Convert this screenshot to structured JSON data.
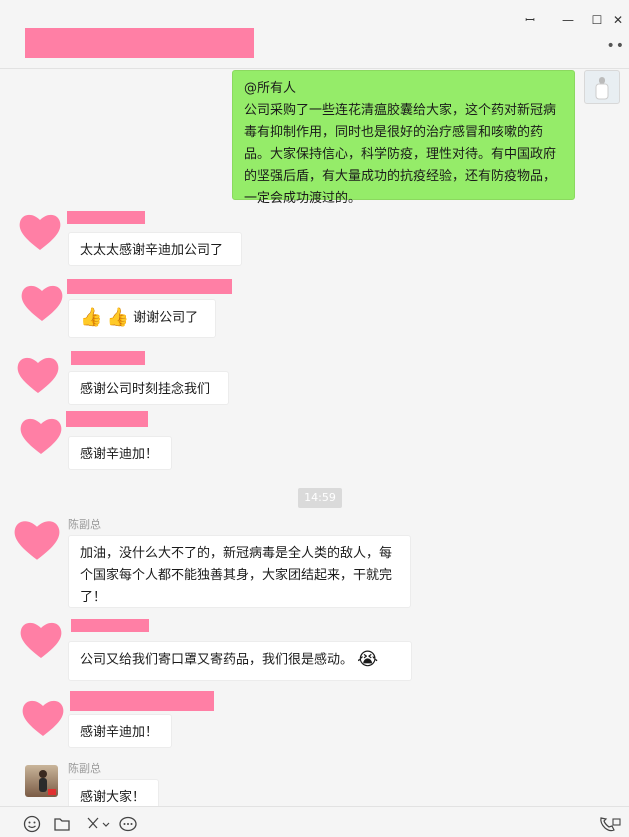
{
  "window": {
    "pin_glyph": "ꟷ",
    "minimize_glyph": "—",
    "maximize_glyph": "☐",
    "close_glyph": "✕",
    "more_glyph": "••"
  },
  "messages": {
    "m1": {
      "sender_line": "@所有人",
      "text": "公司采购了一些连花清瘟胶囊给大家，这个药对新冠病毒有抑制作用，同时也是很好的治疗感冒和咳嗽的药品。大家保持信心，科学防疫，理性对待。有中国政府的坚强后盾，有大量成功的抗疫经验，还有防疫物品，一定会成功渡过的。"
    },
    "m2": {
      "text": "太太太感谢辛迪加公司了"
    },
    "m3": {
      "emoji1": "👍",
      "emoji2": "👍",
      "text": "谢谢公司了"
    },
    "m4": {
      "text": "感谢公司时刻挂念我们"
    },
    "m5": {
      "text": "感谢辛迪加！"
    },
    "time_divider": "14:59",
    "m6": {
      "name": "陈副总",
      "text": "加油，没什么大不了的，新冠病毒是全人类的敌人，每个国家每个人都不能独善其身，大家团结起来，干就完了！"
    },
    "m7": {
      "text": "公司又给我们寄口罩又寄药品，我们很是感动。",
      "emoji": "😭"
    },
    "m8": {
      "text": "感谢辛迪加！"
    },
    "m9": {
      "name": "陈副总",
      "text": "感谢大家！"
    }
  },
  "toolbar": {
    "icons": [
      "emoji-icon",
      "folder-icon",
      "scissors-icon",
      "chat-history-icon",
      "video-call-icon"
    ]
  },
  "colors": {
    "redaction": "#ff7fa5",
    "my_bubble": "#95ec69",
    "background": "#f5f5f5"
  }
}
